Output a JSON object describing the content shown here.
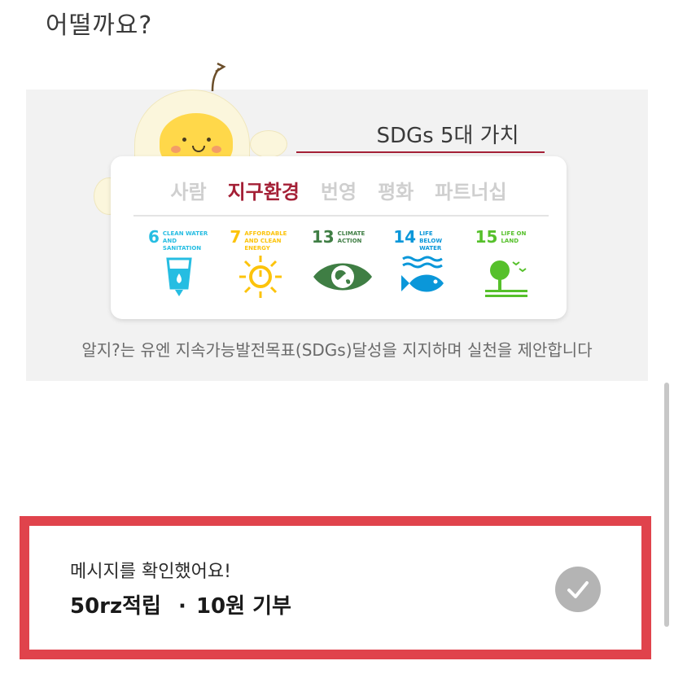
{
  "heading": "어떨까요?",
  "banner": {
    "title": "SDGs 5대 가치",
    "values": [
      "사람",
      "지구환경",
      "번영",
      "평화",
      "파트너십"
    ],
    "active_value": "지구환경",
    "goals": [
      {
        "number": "6",
        "label": "CLEAN WATER AND SANITATION",
        "color": "#26bde2",
        "icon": "water-drop-icon"
      },
      {
        "number": "7",
        "label": "AFFORDABLE AND CLEAN ENERGY",
        "color": "#fcc30b",
        "icon": "sun-power-icon"
      },
      {
        "number": "13",
        "label": "CLIMATE ACTION",
        "color": "#3f7e44",
        "icon": "earth-eye-icon"
      },
      {
        "number": "14",
        "label": "LIFE BELOW WATER",
        "color": "#0a97d9",
        "icon": "fish-icon"
      },
      {
        "number": "15",
        "label": "LIFE ON LAND",
        "color": "#56c02b",
        "icon": "tree-icon"
      }
    ],
    "caption": "알지?는 유엔 지속가능발전목표(SDGs)달성을 지지하며 실천을 제안합니다"
  },
  "message": {
    "confirm_text": "메시지를 확인했어요!",
    "reward": "50rz적립",
    "separator": "·",
    "donation": "10원 기부",
    "check_icon": "checkmark-icon",
    "border_color": "#e0434c"
  }
}
